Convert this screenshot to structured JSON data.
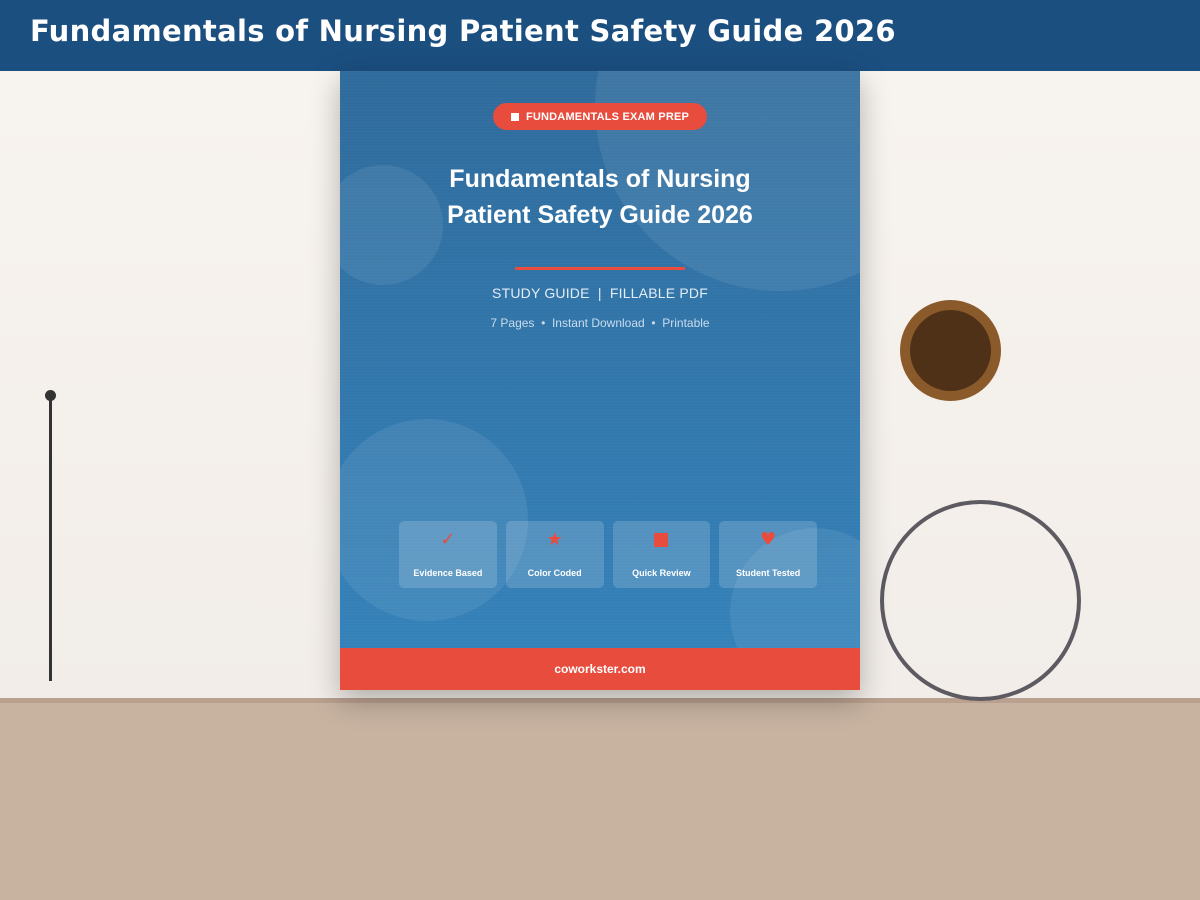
{
  "header": {
    "title": "Fundamentals of Nursing Patient Safety Guide 2026"
  },
  "cover": {
    "badge_label": "FUNDAMENTALS EXAM PREP",
    "title_line1": "Fundamentals of Nursing",
    "title_line2": "Patient Safety Guide 2026",
    "subtitle": "STUDY GUIDE  |  FILLABLE PDF",
    "meta": "7 Pages  •  Instant Download  •  Printable",
    "features": [
      {
        "icon": "check-icon",
        "glyph": "✓",
        "label": "Evidence Based"
      },
      {
        "icon": "star-icon",
        "glyph": "★",
        "label": "Color Coded"
      },
      {
        "icon": "square-icon",
        "glyph": "",
        "label": "Quick Review"
      },
      {
        "icon": "heart-icon",
        "glyph": "♥",
        "label": "Student Tested"
      }
    ],
    "footer_url": "coworkster.com"
  },
  "colors": {
    "header": "#1b4f80",
    "cover_top": "#2f6b9c",
    "cover_bottom": "#3583bb",
    "accent": "#e84c3d",
    "table": "#c8b3a1",
    "wall": "#f8f4f0"
  }
}
